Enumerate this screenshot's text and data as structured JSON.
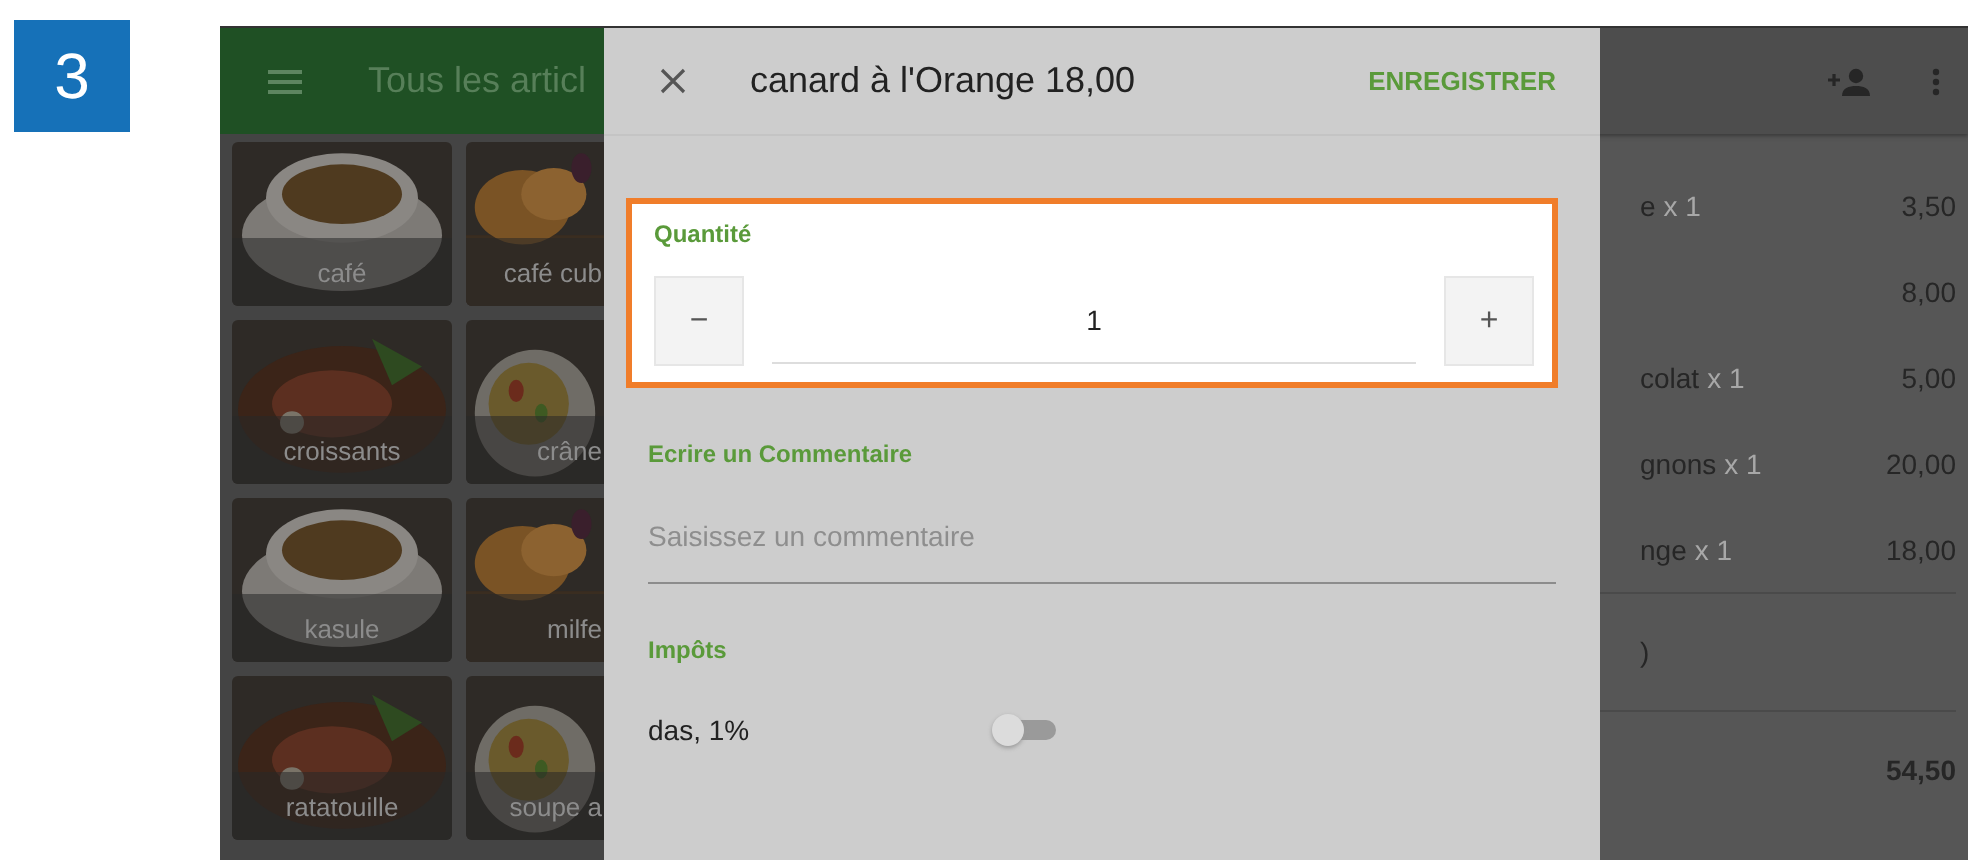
{
  "step": "3",
  "catalog": {
    "title": "Tous les articl",
    "tiles": [
      {
        "label": "café"
      },
      {
        "label": "café cub"
      },
      {
        "label": "croissants"
      },
      {
        "label": "crâne"
      },
      {
        "label": "kasule"
      },
      {
        "label": "milfe"
      },
      {
        "label": "ratatouille"
      },
      {
        "label": "soupe a"
      }
    ]
  },
  "ticket": {
    "lines": [
      {
        "name": "e",
        "qty": "x 1",
        "price": "3,50"
      },
      {
        "price": "8,00"
      },
      {
        "name": "colat",
        "qty": "x 1",
        "price": "5,00"
      },
      {
        "name": "gnons",
        "qty": "x 1",
        "price": "20,00"
      },
      {
        "name": "nge",
        "qty": "x 1",
        "price": "18,00"
      }
    ],
    "line_6": ")",
    "total": "54,50"
  },
  "dialog": {
    "title": "canard à l'Orange 18,00",
    "save": "ENREGISTRER",
    "quantity": {
      "label": "Quantité",
      "value": "1",
      "minus": "−",
      "plus": "+",
      "highlighted": true
    },
    "comment": {
      "label": "Ecrire un Commentaire",
      "placeholder": "Saisissez un commentaire"
    },
    "taxes": {
      "label": "Impôts",
      "items": [
        {
          "name": "das, 1%",
          "on": false
        }
      ]
    }
  }
}
